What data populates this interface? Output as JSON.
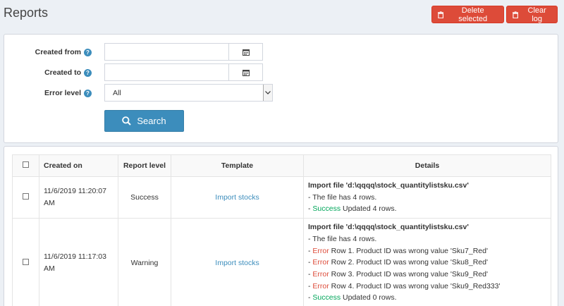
{
  "page": {
    "title": "Reports"
  },
  "toolbar": {
    "delete_label": "Delete selected",
    "clear_label": "Clear log"
  },
  "filters": {
    "created_from_label": "Created from",
    "created_to_label": "Created to",
    "error_level_label": "Error level",
    "created_from_value": "",
    "created_to_value": "",
    "error_level_value": "All",
    "search_label": "Search"
  },
  "table": {
    "headers": {
      "created_on": "Created on",
      "report_level": "Report level",
      "template": "Template",
      "details": "Details"
    },
    "rows": [
      {
        "created_on": "11/6/2019 11:20:07 AM",
        "level": "Success",
        "template": "Import stocks",
        "details_title": "Import file 'd:\\qqqq\\stock_quantitylistsku.csv'",
        "lines": [
          {
            "prefix": "- ",
            "status": "",
            "text": "The file has 4 rows."
          },
          {
            "prefix": "- ",
            "status": "Success",
            "text": " Updated 4 rows."
          }
        ]
      },
      {
        "created_on": "11/6/2019 11:17:03 AM",
        "level": "Warning",
        "template": "Import stocks",
        "details_title": "Import file 'd:\\qqqq\\stock_quantitylistsku.csv'",
        "lines": [
          {
            "prefix": "- ",
            "status": "",
            "text": "The file has 4 rows."
          },
          {
            "prefix": "- ",
            "status": "Error",
            "text": " Row 1. Product ID was wrong value 'Sku7_Red'"
          },
          {
            "prefix": "- ",
            "status": "Error",
            "text": " Row 2. Product ID was wrong value 'Sku8_Red'"
          },
          {
            "prefix": "- ",
            "status": "Error",
            "text": " Row 3. Product ID was wrong value 'Sku9_Red'"
          },
          {
            "prefix": "- ",
            "status": "Error",
            "text": " Row 4. Product ID was wrong value 'Sku9_Red333'"
          },
          {
            "prefix": "- ",
            "status": "Success",
            "text": " Updated 0 rows."
          }
        ]
      }
    ]
  },
  "colors": {
    "primary": "#3c8dbc",
    "danger": "#dd4b39",
    "success": "#00a65a",
    "background": "#ecf0f5"
  }
}
